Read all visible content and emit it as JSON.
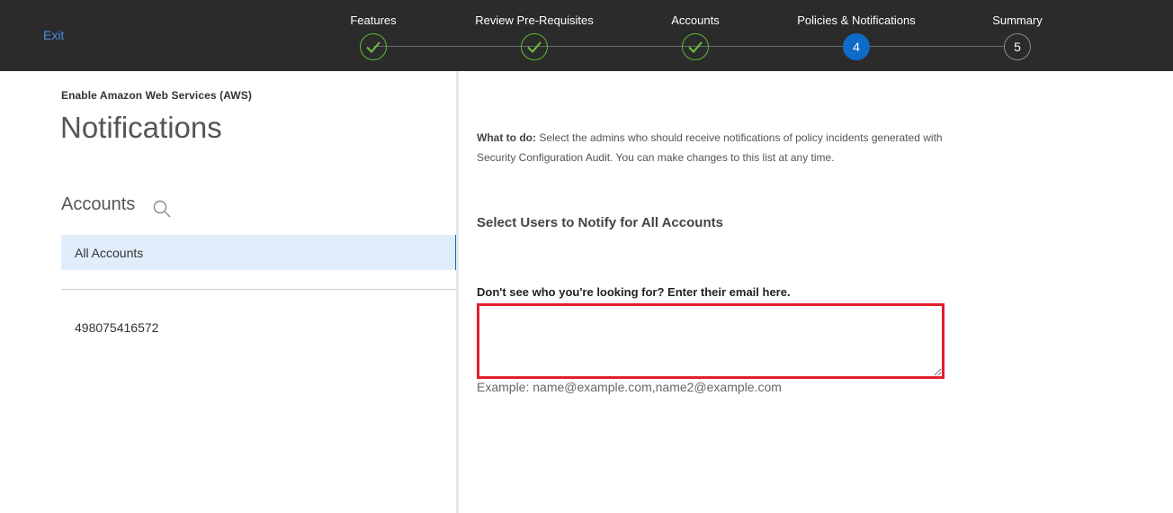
{
  "header": {
    "exit_label": "Exit",
    "steps": [
      {
        "label": "Features",
        "state": "done",
        "number": "1"
      },
      {
        "label": "Review Pre-Requisites",
        "state": "done",
        "number": "2"
      },
      {
        "label": "Accounts",
        "state": "done",
        "number": "3"
      },
      {
        "label": "Policies & Notifications",
        "state": "active",
        "number": "4"
      },
      {
        "label": "Summary",
        "state": "todo",
        "number": "5"
      }
    ]
  },
  "left": {
    "subtitle": "Enable Amazon Web Services (AWS)",
    "title": "Notifications",
    "accounts_heading": "Accounts",
    "search_icon": "search-icon",
    "accounts": [
      {
        "label": "All Accounts",
        "selected": true
      },
      {
        "label": "498075416572",
        "selected": false
      }
    ]
  },
  "main": {
    "what_to_do_label": "What to do:",
    "what_to_do_text": " Select the admins who should receive notifications of policy incidents generated with Security Configuration Audit. You can make changes to this list at any time.",
    "section_heading": "Select Users to Notify for All Accounts",
    "email_label": "Don't see who you're looking for? Enter their email here.",
    "email_value": "",
    "email_example": "Example: name@example.com,name2@example.com"
  },
  "colors": {
    "topbar": "#2b2b2b",
    "done": "#5fb833",
    "active": "#0f6bc8",
    "highlight": "#e0202b"
  }
}
